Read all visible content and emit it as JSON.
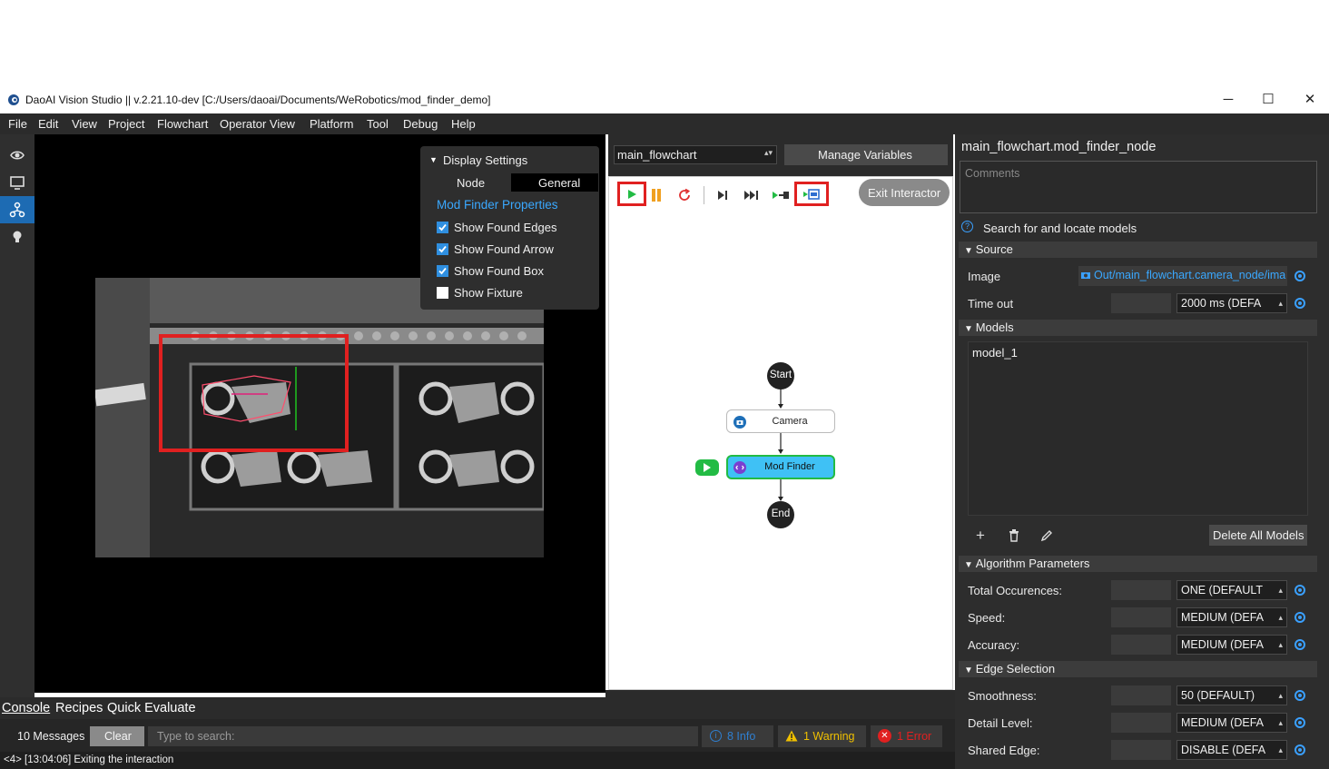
{
  "window": {
    "title": "DaoAI Vision Studio || v.2.21.10-dev   [C:/Users/daoai/Documents/WeRobotics/mod_finder_demo]",
    "minimize": "─",
    "maximize": "☐",
    "close": "✕"
  },
  "menu": [
    "File",
    "Edit",
    "View",
    "Project",
    "Flowchart",
    "Operator View",
    "Platform",
    "Tool",
    "Debug",
    "Help"
  ],
  "display_settings": {
    "header": "Display Settings",
    "tab_node": "Node",
    "tab_general": "General",
    "section": "Mod Finder Properties",
    "options": [
      {
        "label": "Show Found Edges",
        "checked": true
      },
      {
        "label": "Show Found Arrow",
        "checked": true
      },
      {
        "label": "Show Found Box",
        "checked": true
      },
      {
        "label": "Show Fixture",
        "checked": false
      }
    ]
  },
  "flowchart": {
    "selector": "main_flowchart",
    "manage_variables": "Manage Variables",
    "exit_interactor": "Exit Interactor",
    "nodes": {
      "start": "Start",
      "camera": "Camera",
      "mod_finder": "Mod Finder",
      "end": "End"
    }
  },
  "properties": {
    "node_path": "main_flowchart.mod_finder_node",
    "comments_placeholder": "Comments",
    "help_text": "Search for and locate models",
    "source": {
      "header": "Source",
      "image_label": "Image",
      "image_value": "Out/main_flowchart.camera_node/ima",
      "timeout_label": "Time out",
      "timeout_value": "2000 ms (DEFA"
    },
    "models": {
      "header": "Models",
      "items": [
        "model_1"
      ],
      "delete_all": "Delete All Models"
    },
    "algorithm": {
      "header": "Algorithm Parameters",
      "rows": [
        {
          "label": "Total Occurences:",
          "value": "ONE (DEFAULT"
        },
        {
          "label": "Speed:",
          "value": "MEDIUM (DEFA"
        },
        {
          "label": "Accuracy:",
          "value": "MEDIUM (DEFA"
        }
      ]
    },
    "edge": {
      "header": "Edge Selection",
      "rows": [
        {
          "label": "Smoothness:",
          "value": "50 (DEFAULT)"
        },
        {
          "label": "Detail Level:",
          "value": "MEDIUM (DEFA"
        },
        {
          "label": "Shared Edge:",
          "value": "DISABLE (DEFA"
        }
      ]
    }
  },
  "console": {
    "tabs": [
      "Console",
      "Recipes",
      "Quick Evaluate"
    ],
    "message_count": "10 Messages",
    "clear": "Clear",
    "search_placeholder": "Type to search:",
    "info": "8 Info",
    "warning": "1 Warning",
    "error": "1 Error",
    "last_line": "<4> [13:04:06] Exiting the interaction"
  },
  "colors": {
    "accent": "#1d6bb3",
    "highlight_red": "#e02020",
    "play_green": "#22bb44",
    "node_selected": "#3fc1f5"
  }
}
